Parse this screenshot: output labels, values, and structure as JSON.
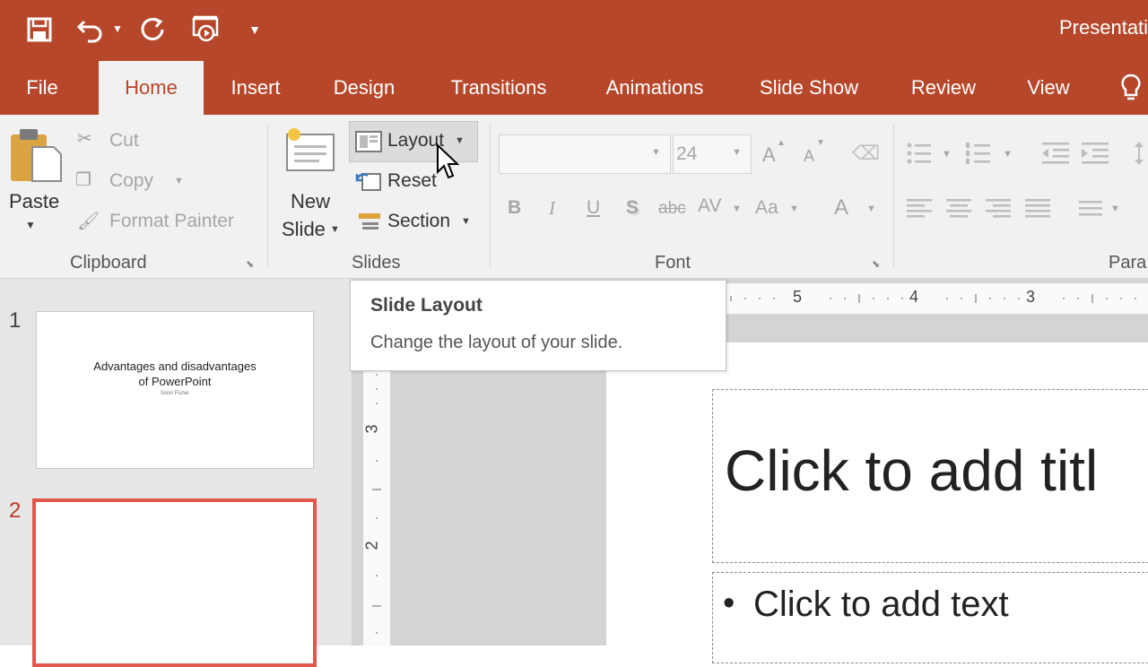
{
  "titlebar": {
    "doc_title": "Presentati",
    "qat_icons": [
      "save-icon",
      "undo-icon",
      "redo-icon",
      "start-from-beginning-icon",
      "customize-qat-icon"
    ]
  },
  "tabs": [
    {
      "label": "File"
    },
    {
      "label": "Home"
    },
    {
      "label": "Insert"
    },
    {
      "label": "Design"
    },
    {
      "label": "Transitions"
    },
    {
      "label": "Animations"
    },
    {
      "label": "Slide Show"
    },
    {
      "label": "Review"
    },
    {
      "label": "View"
    }
  ],
  "ribbon": {
    "clipboard": {
      "paste": "Paste",
      "cut": "Cut",
      "copy": "Copy",
      "format_painter": "Format Painter",
      "group": "Clipboard"
    },
    "slides": {
      "new_slide_1": "New",
      "new_slide_2": "Slide",
      "layout": "Layout",
      "reset": "Reset",
      "section": "Section",
      "group": "Slides"
    },
    "font": {
      "font_name": "",
      "font_size": "24",
      "bold": "B",
      "italic": "I",
      "underline": "U",
      "shadow": "S",
      "strikethrough": "abc",
      "spacing": "AV",
      "change_case": "Aa",
      "font_color": "A",
      "grow": "A",
      "shrink": "A",
      "group": "Font"
    },
    "paragraph": {
      "group": "Para"
    }
  },
  "tooltip": {
    "title": "Slide Layout",
    "description": "Change the layout of your slide."
  },
  "thumbnails": [
    {
      "num": "1",
      "title_line1": "Advantages and disadvantages",
      "title_line2": "of PowerPoint",
      "subtitle": "Sorel Fisher"
    },
    {
      "num": "2"
    }
  ],
  "rulers": {
    "h_labels": [
      "5",
      "4",
      "3"
    ],
    "v_labels": [
      "3",
      "2"
    ]
  },
  "slide": {
    "title_placeholder": "Click to add titl",
    "bullet": "•",
    "text_placeholder": "Click to add text"
  },
  "colors": {
    "accent": "#b7472a",
    "selected_border": "#e2574c"
  }
}
